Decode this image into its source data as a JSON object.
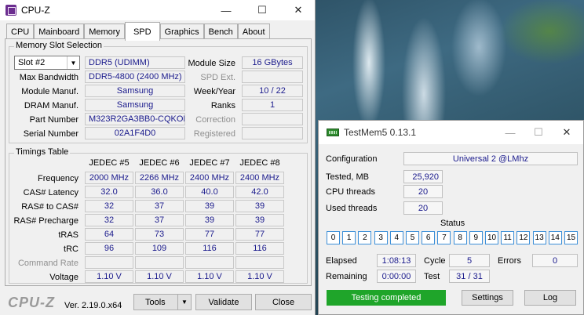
{
  "cpuz": {
    "title": "CPU-Z",
    "controls": {
      "minimize": "—",
      "maximize": "☐",
      "close": "✕"
    },
    "tabs": [
      "CPU",
      "Mainboard",
      "Memory",
      "SPD",
      "Graphics",
      "Bench",
      "About"
    ],
    "active_tab": "SPD",
    "slot_group": {
      "title": "Memory Slot Selection",
      "slot": "Slot #2",
      "type": "DDR5 (UDIMM)",
      "module_size_label": "Module Size",
      "module_size": "16 GBytes",
      "max_bw_label": "Max Bandwidth",
      "max_bw": "DDR5-4800 (2400 MHz)",
      "spd_ext_label": "SPD Ext.",
      "spd_ext": "",
      "manuf_label": "Module Manuf.",
      "manuf": "Samsung",
      "week_year_label": "Week/Year",
      "week_year": "10 / 22",
      "dram_label": "DRAM Manuf.",
      "dram": "Samsung",
      "ranks_label": "Ranks",
      "ranks": "1",
      "part_label": "Part Number",
      "part": "M323R2GA3BB0-CQKOL",
      "correction_label": "Correction",
      "correction": "",
      "serial_label": "Serial Number",
      "serial": "02A1F4D0",
      "registered_label": "Registered",
      "registered": ""
    },
    "timings": {
      "title": "Timings Table",
      "columns": [
        "JEDEC #5",
        "JEDEC #6",
        "JEDEC #7",
        "JEDEC #8"
      ],
      "rows": [
        {
          "label": "Frequency",
          "values": [
            "2000 MHz",
            "2266 MHz",
            "2400 MHz",
            "2400 MHz"
          ],
          "dim": false
        },
        {
          "label": "CAS# Latency",
          "values": [
            "32.0",
            "36.0",
            "40.0",
            "42.0"
          ],
          "dim": false
        },
        {
          "label": "RAS# to CAS#",
          "values": [
            "32",
            "37",
            "39",
            "39"
          ],
          "dim": false
        },
        {
          "label": "RAS# Precharge",
          "values": [
            "32",
            "37",
            "39",
            "39"
          ],
          "dim": false
        },
        {
          "label": "tRAS",
          "values": [
            "64",
            "73",
            "77",
            "77"
          ],
          "dim": false
        },
        {
          "label": "tRC",
          "values": [
            "96",
            "109",
            "116",
            "116"
          ],
          "dim": false
        },
        {
          "label": "Command Rate",
          "values": [
            "",
            "",
            "",
            ""
          ],
          "dim": true
        },
        {
          "label": "Voltage",
          "values": [
            "1.10 V",
            "1.10 V",
            "1.10 V",
            "1.10 V"
          ],
          "dim": false
        }
      ]
    },
    "footer": {
      "logo": "CPU-Z",
      "version": "Ver. 2.19.0.x64",
      "tools": "Tools",
      "validate": "Validate",
      "close": "Close"
    }
  },
  "testmem": {
    "title": "TestMem5  0.13.1",
    "controls": {
      "minimize": "—",
      "maximize": "☐",
      "close": "✕"
    },
    "configuration_label": "Configuration",
    "configuration": "Universal 2 @LMhz",
    "tested_label": "Tested, MB",
    "tested": "25,920",
    "cpu_threads_label": "CPU threads",
    "cpu_threads": "20",
    "used_threads_label": "Used threads",
    "used_threads": "20",
    "status_label": "Status",
    "status_cells": [
      "0",
      "1",
      "2",
      "3",
      "4",
      "5",
      "6",
      "7",
      "8",
      "9",
      "10",
      "11",
      "12",
      "13",
      "14",
      "15"
    ],
    "elapsed_label": "Elapsed",
    "elapsed": "1:08:13",
    "cycle_label": "Cycle",
    "cycle": "5",
    "errors_label": "Errors",
    "errors": "0",
    "remaining_label": "Remaining",
    "remaining": "0:00:00",
    "test_label": "Test",
    "test": "31 / 31",
    "progress_text": "Testing completed",
    "settings": "Settings",
    "log": "Log",
    "accent": "#1fa52a"
  }
}
